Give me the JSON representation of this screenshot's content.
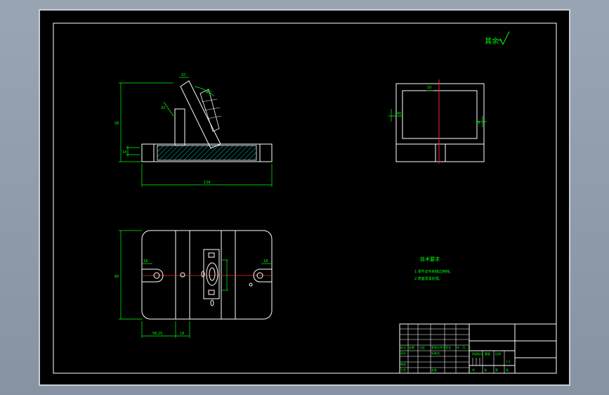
{
  "drawing": {
    "roughness_mark": "其余",
    "tech_requirements": {
      "title": "技术要求",
      "items": [
        "1.零件去毛刺锐边倒钝。",
        "2.表面发黑处理。"
      ]
    },
    "front_view": {
      "dim_height": "58",
      "dim_width": "134",
      "dim_side": "14",
      "dim_top": "10",
      "dim_angle_a": "20",
      "dim_angle_b": "45°"
    },
    "side_view": {
      "dim_left": "40",
      "dim_right": "18",
      "dim_top": "10"
    },
    "plan_view": {
      "dim_height": "80",
      "dim_bottom_a": "58.25",
      "dim_bottom_b": "18",
      "dim_left": "18",
      "dim_right": "18"
    },
    "title_block": {
      "labels": [
        "标记",
        "处数",
        "分区",
        "更改文件号",
        "签名",
        "年、月、日"
      ],
      "design": "设计",
      "check": "审核",
      "process": "工艺",
      "approve": "批准",
      "stage": "阶段标记",
      "weight": "重量",
      "scale": "比例",
      "scale_value": "1:1",
      "sheet": "共",
      "sheet2": "张",
      "page": "第",
      "page2": "张",
      "standard": "标准化"
    }
  }
}
